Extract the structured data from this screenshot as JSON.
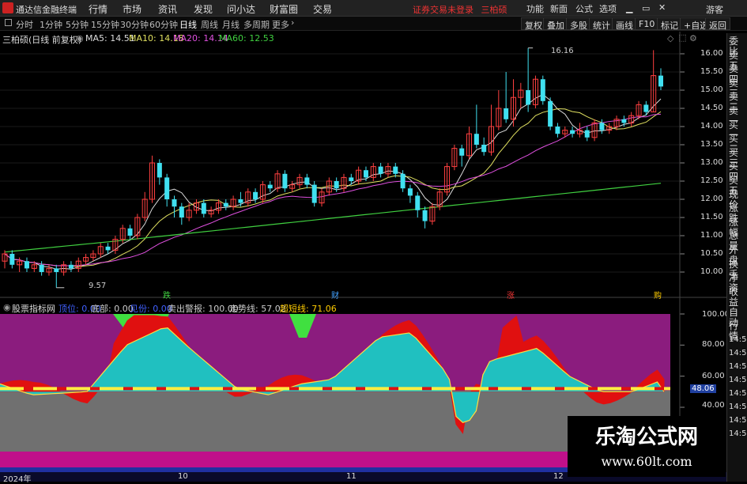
{
  "titlebar": {
    "app_title": "通达信金融终端",
    "menus": [
      "行情",
      "市场",
      "资讯",
      "发现",
      "问小达",
      "财富圈",
      "交易"
    ],
    "status": "证券交易未登录",
    "status_name": "三柏硕",
    "right_buttons": [
      "功能",
      "新面",
      "公式",
      "选项"
    ],
    "guest": "游客"
  },
  "toolbar": {
    "periods": [
      "分时",
      "1分钟",
      "5分钟",
      "15分钟",
      "30分钟",
      "60分钟",
      "日线",
      "周线",
      "月线",
      "多周期",
      "更多"
    ],
    "active_period": "日线",
    "buttons": [
      "复权",
      "叠加",
      "多股",
      "统计",
      "画线",
      "F10",
      "标记",
      "+自选",
      "返回"
    ]
  },
  "main": {
    "stock": "三柏硕(日线 前复权)",
    "ma": [
      {
        "label": "MA5: 14.51",
        "color": "#dddddd"
      },
      {
        "label": "MA10: 14.18",
        "color": "#e0e060"
      },
      {
        "label": "MA20: 14.14",
        "color": "#e050e0"
      },
      {
        "label": "MA60: 12.53",
        "color": "#40d040"
      }
    ],
    "y_labels": [
      "16.00",
      "15.50",
      "15.00",
      "14.50",
      "14.00",
      "13.50",
      "13.00",
      "12.50",
      "12.00",
      "11.50",
      "11.00",
      "10.50",
      "10.00"
    ],
    "high_label": "16.16",
    "low_label": "9.57",
    "markers": [
      {
        "t": "跌",
        "color": "#40d040"
      },
      {
        "t": "财",
        "color": "#40a0ff"
      },
      {
        "t": "涨",
        "color": "#e33"
      },
      {
        "t": "购",
        "color": "#ffcc00"
      }
    ]
  },
  "sidebar": [
    "委比",
    "卖五",
    "卖四",
    "卖三",
    "卖二",
    "卖一",
    "买一",
    "买二",
    "买三",
    "买四",
    "买五",
    "现价",
    "涨跌",
    "涨幅",
    "总量",
    "外盘",
    "换手",
    "净资",
    "收益"
  ],
  "indicator": {
    "name": "股票指标网",
    "fields": [
      {
        "t": "顶位: 0.00",
        "c": "#4060ff"
      },
      {
        "t": "底部: 0.00",
        "c": "#ccc"
      },
      {
        "t": "见份: 0.00",
        "c": "#4060ff"
      },
      {
        "t": "卖出警报: 100.00",
        "c": "#ccc"
      },
      {
        "t": "走势线: 57.02",
        "c": "#ccc"
      },
      {
        "t": "超短线: 71.06",
        "c": "#ffcc00"
      }
    ],
    "y_labels": [
      "100.00",
      "80.00",
      "60.00",
      "48.06",
      "40.00"
    ]
  },
  "sidebar2": [
    "自动",
    "行情",
    "14:50",
    "14:50",
    "14:50",
    "14:50",
    "14:50",
    "14:50",
    "14:50",
    "14:50"
  ],
  "time_axis": [
    "2024年",
    "10",
    "11",
    "12"
  ],
  "watermark": {
    "title": "乐淘公式网",
    "url": "www.60lt.com"
  }
}
